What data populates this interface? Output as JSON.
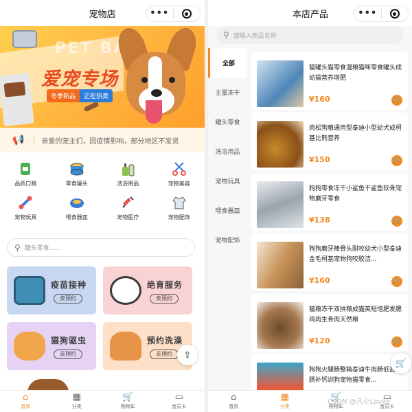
{
  "left": {
    "title": "宠物店",
    "banner": {
      "watermark_text": "PET BAR",
      "headline": "爱宠专场",
      "tag_new": "冬季新品",
      "tag_hot": "正在热卖"
    },
    "notice": "亲爱的宠主们，因疫情影响，部分地区不发货",
    "categories": [
      {
        "label": "品质口粮",
        "icon": "food-bag-icon"
      },
      {
        "label": "零食罐头",
        "icon": "can-icon"
      },
      {
        "label": "洗浴用品",
        "icon": "bath-bottle-icon"
      },
      {
        "label": "宠物美容",
        "icon": "grooming-icon"
      },
      {
        "label": "宠物玩具",
        "icon": "toy-bone-icon"
      },
      {
        "label": "喂食器皿",
        "icon": "bowl-icon"
      },
      {
        "label": "宠物医疗",
        "icon": "syringe-icon"
      },
      {
        "label": "宠物配饰",
        "icon": "clothes-icon"
      }
    ],
    "search_placeholder": "罐头零食......",
    "services": [
      {
        "title": "疫苗接种",
        "button": "去预约"
      },
      {
        "title": "绝育服务",
        "button": "去预约"
      },
      {
        "title": "猫狗驱虫",
        "button": "去预约"
      },
      {
        "title": "预约洗澡",
        "button": "去预约"
      }
    ]
  },
  "right": {
    "title": "本店产品",
    "search_placeholder": "请输入商品名称",
    "sidebar": [
      "全部",
      "主量冻干",
      "罐头零食",
      "洗浴用品",
      "宠物玩具",
      "喂食器皿",
      "宠物配饰"
    ],
    "products": [
      {
        "name": "猫罐头猫零食湿粮猫咪零食罐头成幼猫营养增肥",
        "price": "¥160"
      },
      {
        "name": "肉松狗粮通用型泰迪小型幼犬成柯基比熊营养",
        "price": "¥150"
      },
      {
        "name": "狗狗零食冻干小鲨鱼干鲨鱼软骨宠物磨牙零食",
        "price": "¥138"
      },
      {
        "name": "狗狗磨牙棒骨头耐咬幼犬小型泰迪金毛柯基宠物狗咬胶洁...",
        "price": "¥160"
      },
      {
        "name": "猫粮冻干双拼粮成猫英短增肥发腮鸡肉生骨肉天然粮",
        "price": "¥120"
      },
      {
        "name": "狗狗火腿肠整箱泰迪牛肉肠低盐香肠补钙训狗宠物猫零食...",
        "price": ""
      }
    ]
  },
  "tabbar": [
    "首页",
    "分类",
    "购物车",
    "会员卡"
  ],
  "watermark": "CSDN @凡小Lovee",
  "colors": {
    "accent": "#f08b23",
    "banner": "#ffb23c",
    "notice_bg": "#fff6e8"
  }
}
